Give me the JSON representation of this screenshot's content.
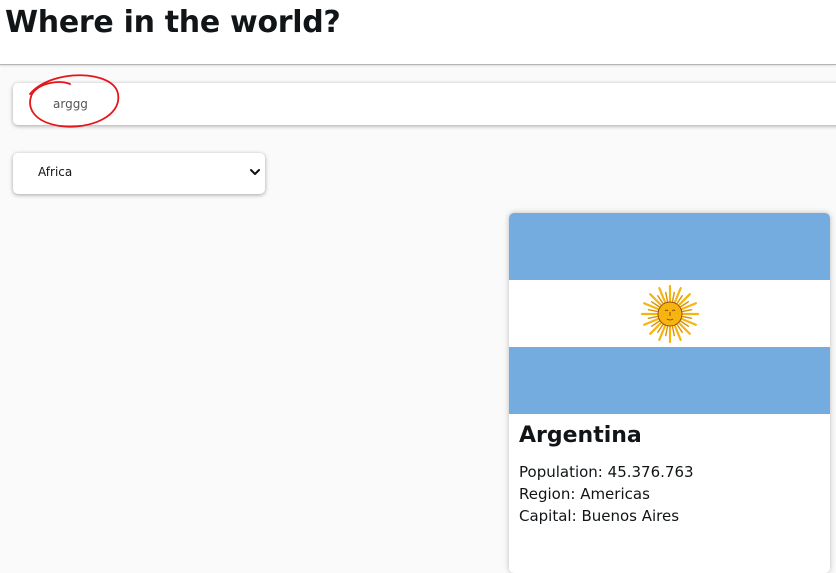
{
  "header": {
    "title": "Where in the world?"
  },
  "search": {
    "value": "arggg",
    "placeholder": ""
  },
  "filter": {
    "selected": "Africa"
  },
  "colors": {
    "flag_blue": "#74acdf",
    "flag_white": "#ffffff",
    "sun_gold": "#f6b40e",
    "sun_brown": "#85340a",
    "annotation_red": "#e5161b"
  },
  "countries": [
    {
      "name": "Argentina",
      "population_label": "Population:",
      "population": "45.376.763",
      "region_label": "Region:",
      "region": "Americas",
      "capital_label": "Capital:",
      "capital": "Buenos Aires"
    }
  ]
}
